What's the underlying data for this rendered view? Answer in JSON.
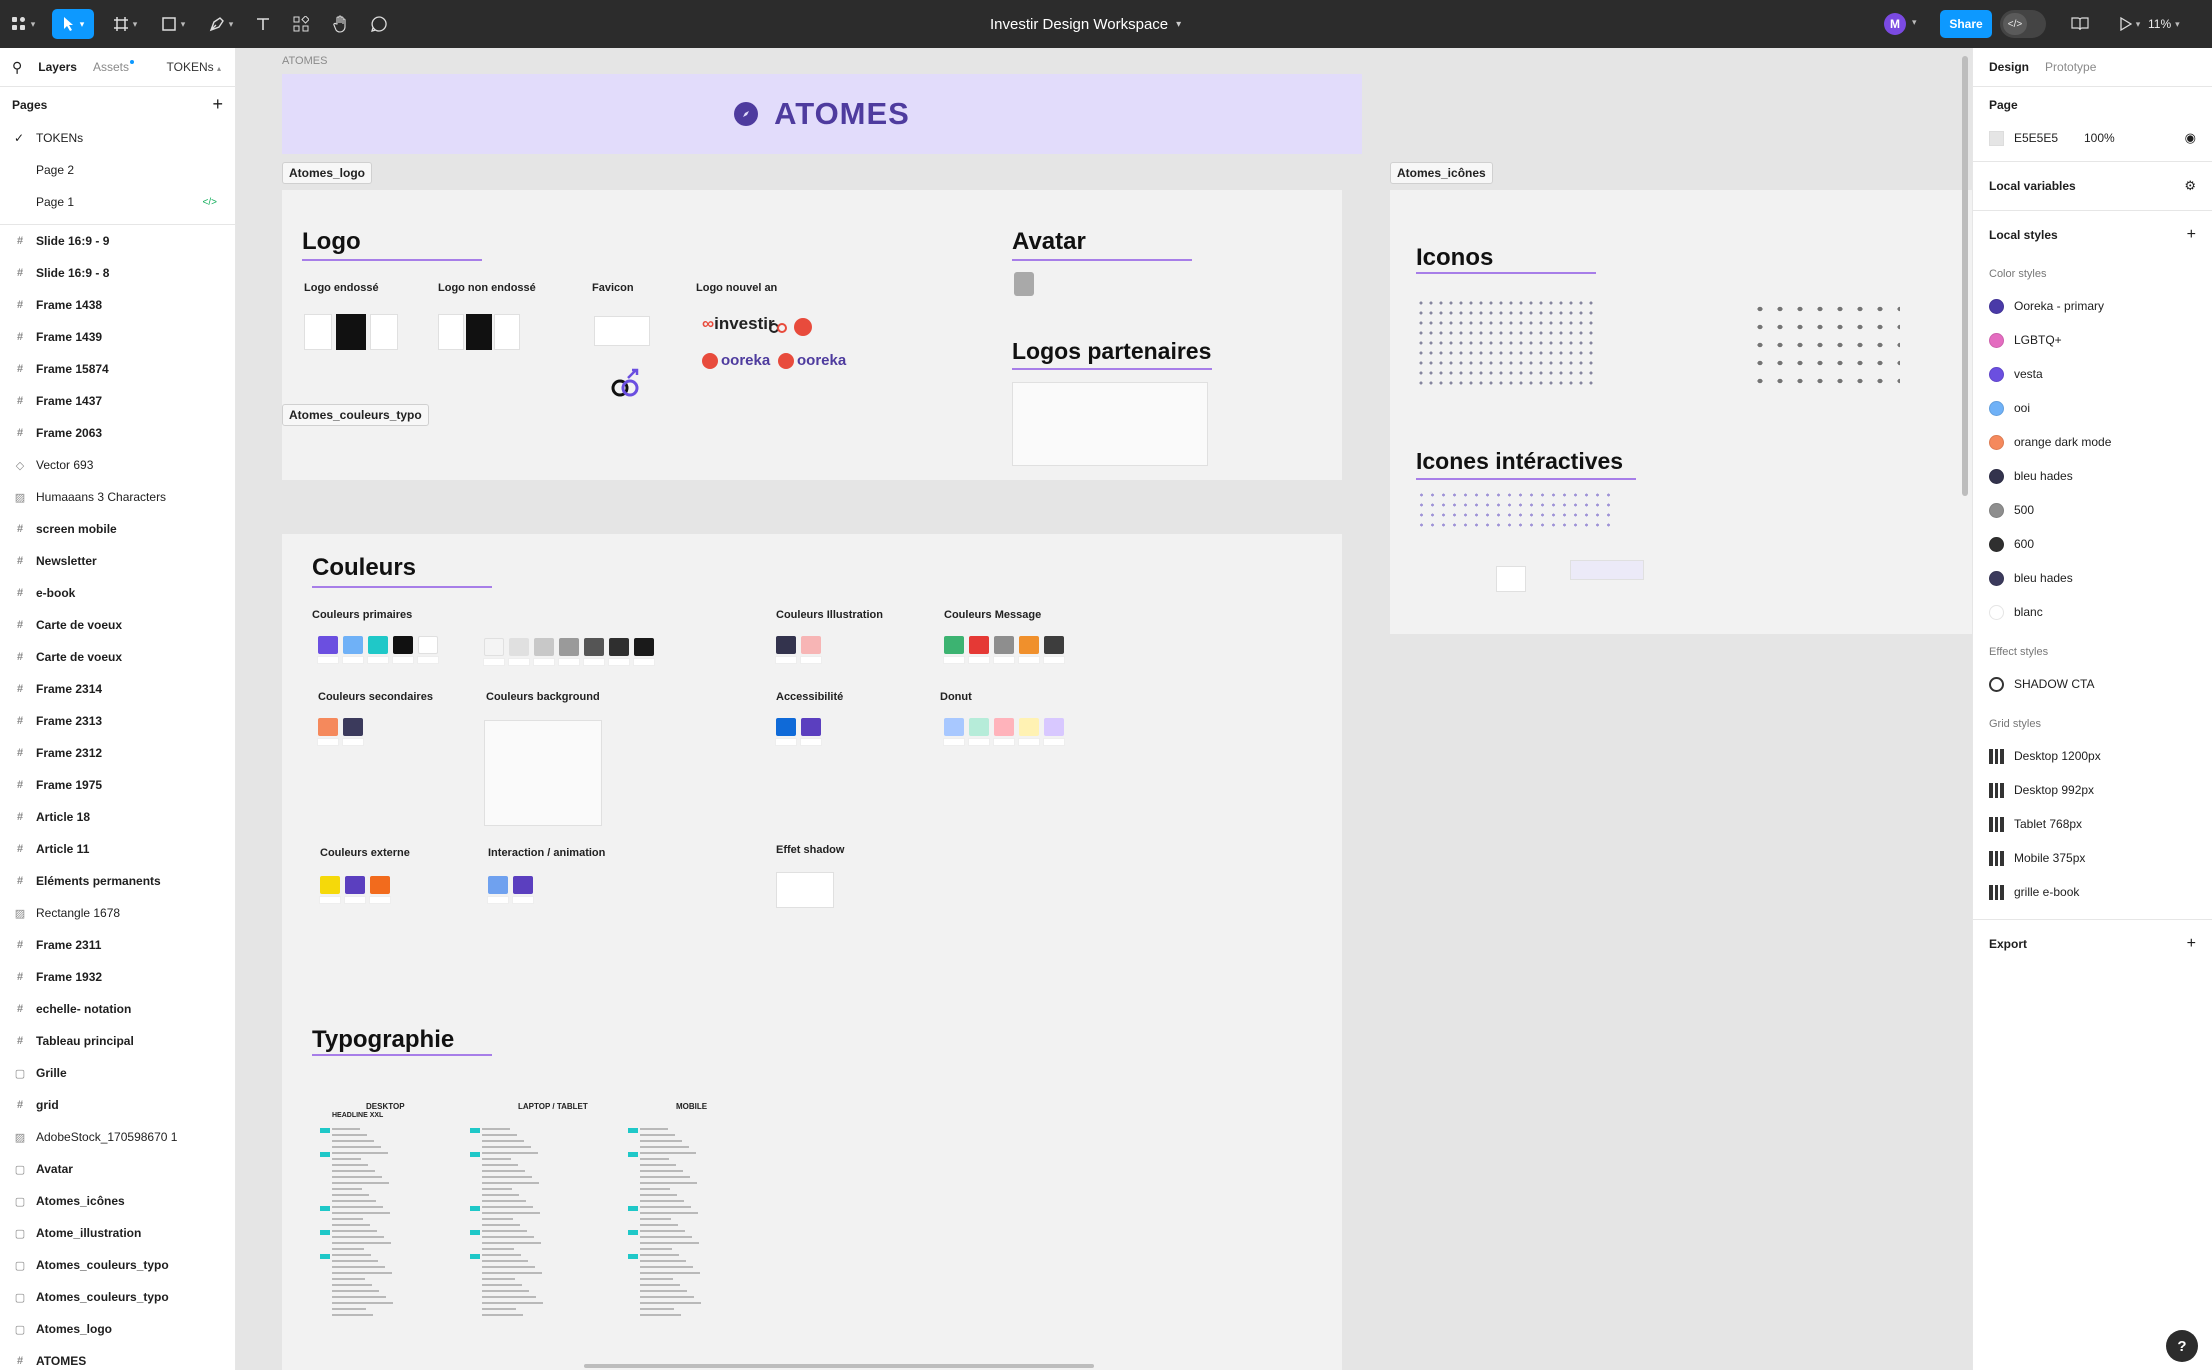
{
  "toolbar": {
    "file_title": "Investir Design Workspace",
    "share_label": "Share",
    "zoom": "11%",
    "user_initial": "M"
  },
  "left_panel": {
    "tabs": {
      "layers": "Layers",
      "assets": "Assets",
      "tokens": "TOKENs"
    },
    "pages_title": "Pages",
    "pages": [
      "TOKENs",
      "Page 2",
      "Page 1"
    ],
    "layers": [
      {
        "icon": "grid",
        "label": "Slide 16:9 - 9",
        "bold": true
      },
      {
        "icon": "grid",
        "label": "Slide 16:9 - 8",
        "bold": true
      },
      {
        "icon": "grid",
        "label": "Frame 1438",
        "bold": true
      },
      {
        "icon": "grid",
        "label": "Frame 1439",
        "bold": true
      },
      {
        "icon": "grid",
        "label": "Frame 15874",
        "bold": true
      },
      {
        "icon": "grid",
        "label": "Frame 1437",
        "bold": true
      },
      {
        "icon": "grid",
        "label": "Frame 2063",
        "bold": true
      },
      {
        "icon": "vector",
        "label": "Vector 693",
        "bold": false
      },
      {
        "icon": "image",
        "label": "Humaaans 3 Characters",
        "bold": false
      },
      {
        "icon": "grid",
        "label": "screen mobile",
        "bold": true
      },
      {
        "icon": "grid",
        "label": "Newsletter",
        "bold": true
      },
      {
        "icon": "grid",
        "label": "e-book",
        "bold": true
      },
      {
        "icon": "grid",
        "label": "Carte de voeux",
        "bold": true
      },
      {
        "icon": "grid",
        "label": "Carte de voeux",
        "bold": true
      },
      {
        "icon": "grid",
        "label": "Frame 2314",
        "bold": true
      },
      {
        "icon": "grid",
        "label": "Frame 2313",
        "bold": true
      },
      {
        "icon": "grid",
        "label": "Frame 2312",
        "bold": true
      },
      {
        "icon": "grid",
        "label": "Frame 1975",
        "bold": true
      },
      {
        "icon": "grid",
        "label": "Article 18",
        "bold": true
      },
      {
        "icon": "grid",
        "label": "Article 11",
        "bold": true
      },
      {
        "icon": "grid",
        "label": "Eléments permanents",
        "bold": true
      },
      {
        "icon": "image",
        "label": "Rectangle 1678",
        "bold": false
      },
      {
        "icon": "grid",
        "label": "Frame 2311",
        "bold": true
      },
      {
        "icon": "grid",
        "label": "Frame 1932",
        "bold": true
      },
      {
        "icon": "grid",
        "label": "echelle- notation",
        "bold": true
      },
      {
        "icon": "grid",
        "label": "Tableau principal",
        "bold": true
      },
      {
        "icon": "frame",
        "label": "Grille",
        "bold": true
      },
      {
        "icon": "grid",
        "label": "grid",
        "bold": true
      },
      {
        "icon": "image",
        "label": "AdobeStock_170598670 1",
        "bold": false
      },
      {
        "icon": "frame",
        "label": "Avatar",
        "bold": true
      },
      {
        "icon": "frame",
        "label": "Atomes_icônes",
        "bold": true
      },
      {
        "icon": "frame",
        "label": "Atome_illustration",
        "bold": true
      },
      {
        "icon": "frame",
        "label": "Atomes_couleurs_typo",
        "bold": true
      },
      {
        "icon": "frame",
        "label": "Atomes_couleurs_typo",
        "bold": true
      },
      {
        "icon": "frame",
        "label": "Atomes_logo",
        "bold": true
      },
      {
        "icon": "grid",
        "label": "ATOMES",
        "bold": true
      }
    ]
  },
  "canvas": {
    "atomes_section_label": "ATOMES",
    "atomes_banner_title": "ATOMES",
    "frame_tags": {
      "logo": "Atomes_logo",
      "icones": "Atomes_icônes",
      "couleurs": "Atomes_couleurs_typo"
    },
    "logo_frame": {
      "heading": "Logo",
      "labels": [
        "Logo endossé",
        "Logo non endossé",
        "Favicon",
        "Logo nouvel an"
      ],
      "avatar_heading": "Avatar",
      "partners_heading": "Logos partenaires",
      "brand_word_1": "investir",
      "brand_word_2": "ooreka",
      "brand_word_3": "ooreka"
    },
    "icones_frame": {
      "heading": "Iconos",
      "interactive_heading": "Icones intéractives"
    },
    "couleurs_frame": {
      "heading": "Couleurs",
      "groups": {
        "primaires": "Couleurs primaires",
        "illustration": "Couleurs Illustration",
        "message": "Couleurs Message",
        "secondaires": "Couleurs secondaires",
        "background": "Couleurs background",
        "accessibilite": "Accessibilité",
        "donut": "Donut",
        "externe": "Couleurs externe",
        "interaction": "Interaction / animation",
        "shadow": "Effet shadow"
      },
      "typo_heading": "Typographie",
      "typo_columns": [
        "DESKTOP",
        "LAPTOP / TABLET",
        "MOBILE"
      ],
      "typo_first_row": "HEADLINE XXL"
    },
    "colors": {
      "frame_bg": "#f2f2f2",
      "banner_bg": "#e2dcfb",
      "brand_purple": "#4e3b9e",
      "accent_underline": "#a77ee8"
    }
  },
  "right_panel": {
    "tabs": {
      "design": "Design",
      "prototype": "Prototype"
    },
    "page_section": "Page",
    "page_color": "E5E5E5",
    "page_opacity": "100%",
    "local_variables": "Local variables",
    "local_styles": "Local styles",
    "color_styles_title": "Color styles",
    "color_styles": [
      {
        "name": "Ooreka - primary",
        "color": "#4a3aa8"
      },
      {
        "name": "LGBTQ+",
        "color": "#e46cc0"
      },
      {
        "name": "vesta",
        "color": "#6b4fe0"
      },
      {
        "name": "ooi",
        "color": "#6fb1f7"
      },
      {
        "name": "orange dark mode",
        "color": "#f5895c"
      },
      {
        "name": "bleu hades",
        "color": "#33334d"
      },
      {
        "name": "500",
        "color": "#8e8e8e"
      },
      {
        "name": "600",
        "color": "#2f2f2f"
      },
      {
        "name": "bleu hades",
        "color": "#3b3a5c"
      },
      {
        "name": "blanc",
        "color": "#ffffff"
      }
    ],
    "effect_styles_title": "Effect styles",
    "effect_styles": [
      "SHADOW CTA"
    ],
    "grid_styles_title": "Grid styles",
    "grid_styles": [
      "Desktop 1200px",
      "Desktop 992px",
      "Tablet 768px",
      "Mobile 375px",
      "grille e-book"
    ],
    "export_title": "Export"
  }
}
